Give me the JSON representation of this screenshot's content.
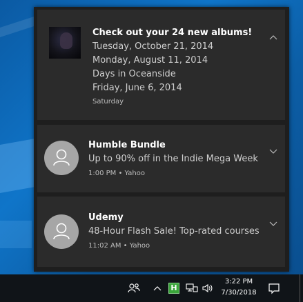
{
  "notifications": [
    {
      "title": "Check out your 24 new albums!",
      "lines": [
        "Tuesday, October 21, 2014",
        "Monday, August 11, 2014",
        "Days in Oceanside",
        "Friday, June 6, 2014"
      ],
      "meta": "Saturday",
      "image": "album-thumbnail",
      "expand_icon": "chevron-up-icon"
    },
    {
      "title": "Humble Bundle",
      "body": "Up to 90% off in the Indie Mega Week",
      "meta": "1:00 PM • Yahoo",
      "avatar": "person-icon",
      "expand_icon": "chevron-down-icon"
    },
    {
      "title": "Udemy",
      "body": "48-Hour Flash Sale! Top-rated courses",
      "meta": "11:02 AM • Yahoo",
      "avatar": "person-icon",
      "expand_icon": "chevron-down-icon"
    }
  ],
  "taskbar": {
    "people_icon": "people-icon",
    "overflow_icon": "chevron-up-icon",
    "tray_app_letter": "H",
    "network_icon": "network-icon",
    "volume_icon": "volume-icon",
    "time": "3:22 PM",
    "date": "7/30/2018",
    "notification_icon": "action-center-icon"
  },
  "colors": {
    "toast_bg": "#2b2b2b",
    "panel_bg": "#1e1e1e",
    "taskbar_bg": "#101418",
    "avatar_bg": "#a6a6a6",
    "tray_app_green": "#3aa53a"
  }
}
